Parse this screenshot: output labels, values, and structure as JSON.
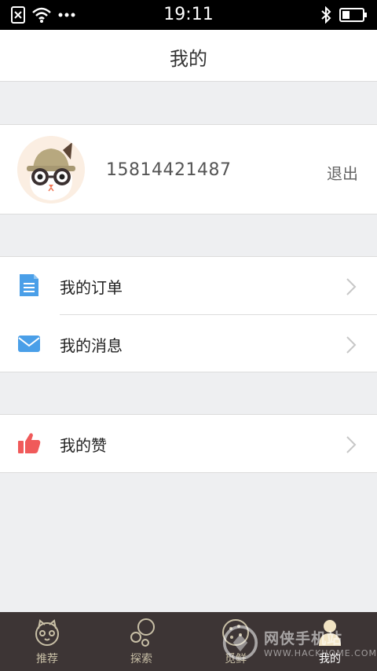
{
  "status_bar": {
    "time": "19:11"
  },
  "header": {
    "title": "我的"
  },
  "profile": {
    "phone": "15814421487",
    "logout_label": "退出"
  },
  "menu": {
    "orders_label": "我的订单",
    "messages_label": "我的消息",
    "likes_label": "我的赞"
  },
  "tabs": [
    {
      "label": "推荐",
      "icon": "cat-face-icon"
    },
    {
      "label": "探索",
      "icon": "bubbles-icon"
    },
    {
      "label": "觅鲜",
      "icon": "cookie-icon"
    },
    {
      "label": "我的",
      "icon": "person-icon",
      "active": true
    }
  ],
  "colors": {
    "tab_bar": "#3d3535",
    "order_icon": "#4a9fe8",
    "message_icon": "#4a9fe8",
    "like_icon": "#f05a5a"
  }
}
